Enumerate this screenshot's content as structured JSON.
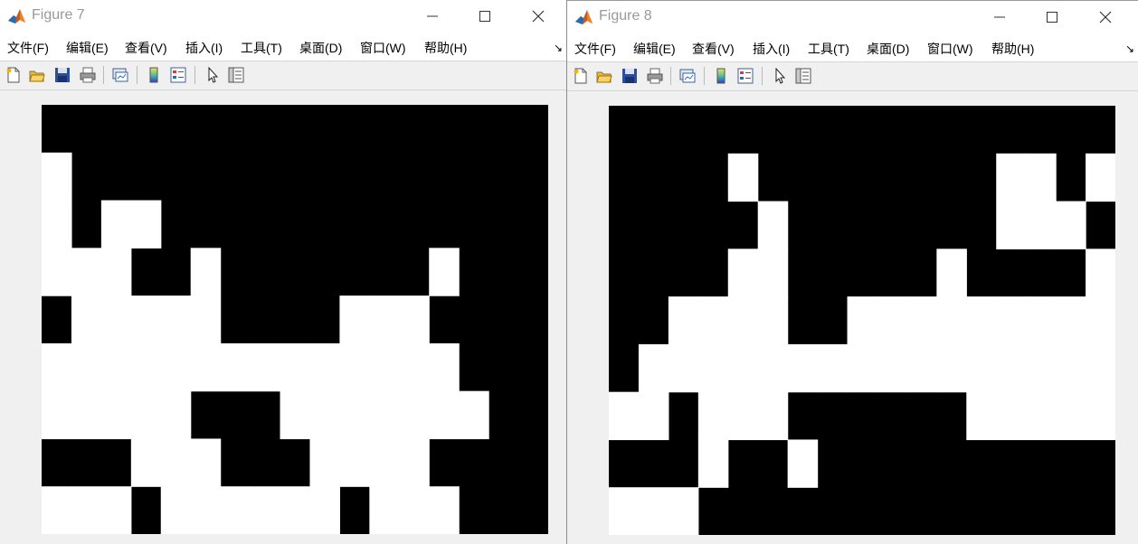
{
  "figures": [
    {
      "title": "Figure 7",
      "menu": [
        "文件(F)",
        "编辑(E)",
        "查看(V)",
        "插入(I)",
        "工具(T)",
        "桌面(D)",
        "窗口(W)",
        "帮助(H)"
      ],
      "toolbar": [
        "new-figure",
        "open-file",
        "save",
        "print",
        "link-plot",
        "colorbar",
        "legend",
        "edit-plot",
        "property-inspector"
      ],
      "image": {
        "rows": 9,
        "cols": 17,
        "white_rows": [
          [],
          [
            0
          ],
          [
            0,
            2,
            3
          ],
          [
            0,
            1,
            2,
            5,
            13
          ],
          [
            1,
            2,
            3,
            4,
            5,
            10,
            11,
            12
          ],
          [
            0,
            1,
            2,
            3,
            4,
            5,
            6,
            7,
            8,
            9,
            10,
            11,
            12,
            13
          ],
          [
            0,
            1,
            2,
            3,
            4,
            8,
            9,
            10,
            11,
            12,
            13,
            14
          ],
          [
            3,
            4,
            5,
            9,
            10,
            11,
            12
          ],
          [
            0,
            1,
            2,
            4,
            5,
            6,
            7,
            8,
            9,
            11,
            12,
            13
          ]
        ]
      }
    },
    {
      "title": "Figure 8",
      "menu": [
        "文件(F)",
        "编辑(E)",
        "查看(V)",
        "插入(I)",
        "工具(T)",
        "桌面(D)",
        "窗口(W)",
        "帮助(H)"
      ],
      "toolbar": [
        "new-figure",
        "open-file",
        "save",
        "print",
        "link-plot",
        "colorbar",
        "legend",
        "edit-plot",
        "property-inspector"
      ],
      "image": {
        "rows": 9,
        "cols": 17,
        "white_rows": [
          [],
          [
            4,
            13,
            14,
            16
          ],
          [
            5,
            13,
            14,
            15
          ],
          [
            4,
            5,
            11,
            16
          ],
          [
            2,
            3,
            4,
            5,
            8,
            9,
            10,
            11,
            12,
            13,
            14,
            15,
            16
          ],
          [
            1,
            2,
            3,
            4,
            5,
            6,
            7,
            8,
            9,
            10,
            11,
            12,
            13,
            14,
            15,
            16
          ],
          [
            0,
            1,
            3,
            4,
            5,
            12,
            13,
            14,
            15,
            16
          ],
          [
            3,
            6
          ],
          [
            0,
            1,
            2
          ]
        ]
      }
    }
  ]
}
